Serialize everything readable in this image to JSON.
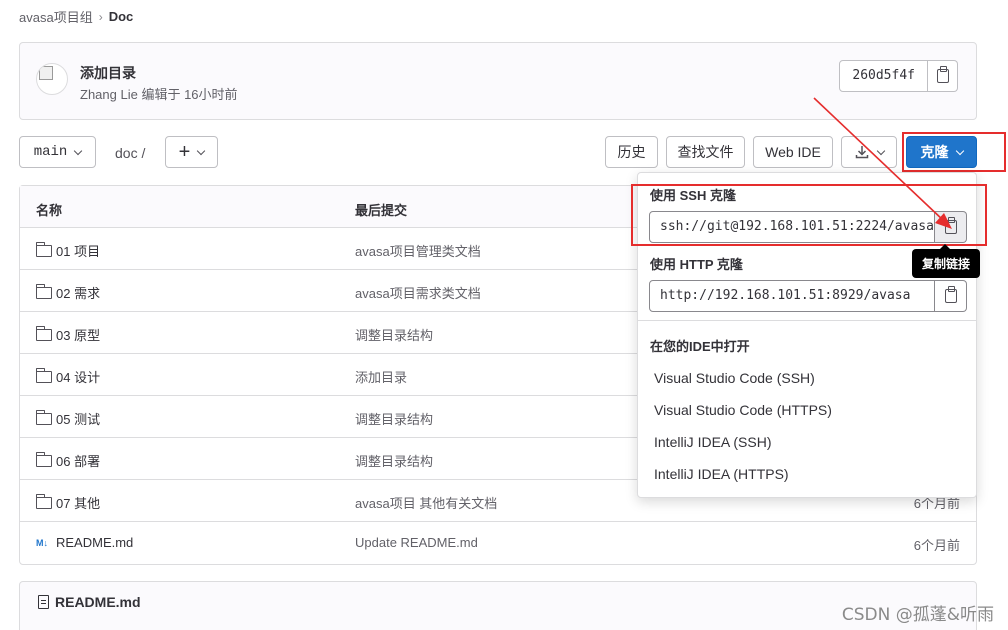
{
  "breadcrumb": {
    "group": "avasa项目组",
    "current": "Doc"
  },
  "commit": {
    "title": "添加目录",
    "author": "Zhang Lie",
    "meta_suffix": "编辑于 16小时前",
    "sha": "260d5f4f"
  },
  "toolbar": {
    "branch": "main",
    "path": "doc /",
    "add_label": "+",
    "history": "历史",
    "find_file": "查找文件",
    "web_ide": "Web IDE",
    "clone": "克隆"
  },
  "table": {
    "headers": {
      "name": "名称",
      "last_commit": "最后提交",
      "updated": ""
    },
    "rows": [
      {
        "name": "01 项目",
        "type": "folder",
        "msg": "avasa项目管理类文档",
        "time": ""
      },
      {
        "name": "02 需求",
        "type": "folder",
        "msg": "avasa项目需求类文档",
        "time": ""
      },
      {
        "name": "03 原型",
        "type": "folder",
        "msg": "调整目录结构",
        "time": ""
      },
      {
        "name": "04 设计",
        "type": "folder",
        "msg": "添加目录",
        "time": ""
      },
      {
        "name": "05 测试",
        "type": "folder",
        "msg": "调整目录结构",
        "time": ""
      },
      {
        "name": "06 部署",
        "type": "folder",
        "msg": "调整目录结构",
        "time": ""
      },
      {
        "name": "07 其他",
        "type": "folder",
        "msg": "avasa项目 其他有关文档",
        "time": "6个月前"
      },
      {
        "name": "README.md",
        "type": "markdown",
        "msg": "Update README.md",
        "time": "6个月前"
      }
    ]
  },
  "readme": {
    "title": "README.md"
  },
  "clone_dropdown": {
    "ssh_label": "使用 SSH 克隆",
    "ssh_url": "ssh://git@192.168.101.51:2224/avasa",
    "http_label": "使用 HTTP 克隆",
    "http_url": "http://192.168.101.51:8929/avasa",
    "ide_label": "在您的IDE中打开",
    "ide_items": [
      "Visual Studio Code (SSH)",
      "Visual Studio Code (HTTPS)",
      "IntelliJ IDEA (SSH)",
      "IntelliJ IDEA (HTTPS)"
    ]
  },
  "tooltip": "复制链接",
  "watermark": "CSDN @孤蓬&听雨",
  "colors": {
    "accent": "#1f75cb",
    "annotation": "#e52d2d"
  },
  "icons": [
    "clipboard-icon",
    "chevron-down-icon",
    "folder-icon",
    "markdown-icon",
    "download-icon",
    "document-icon"
  ]
}
